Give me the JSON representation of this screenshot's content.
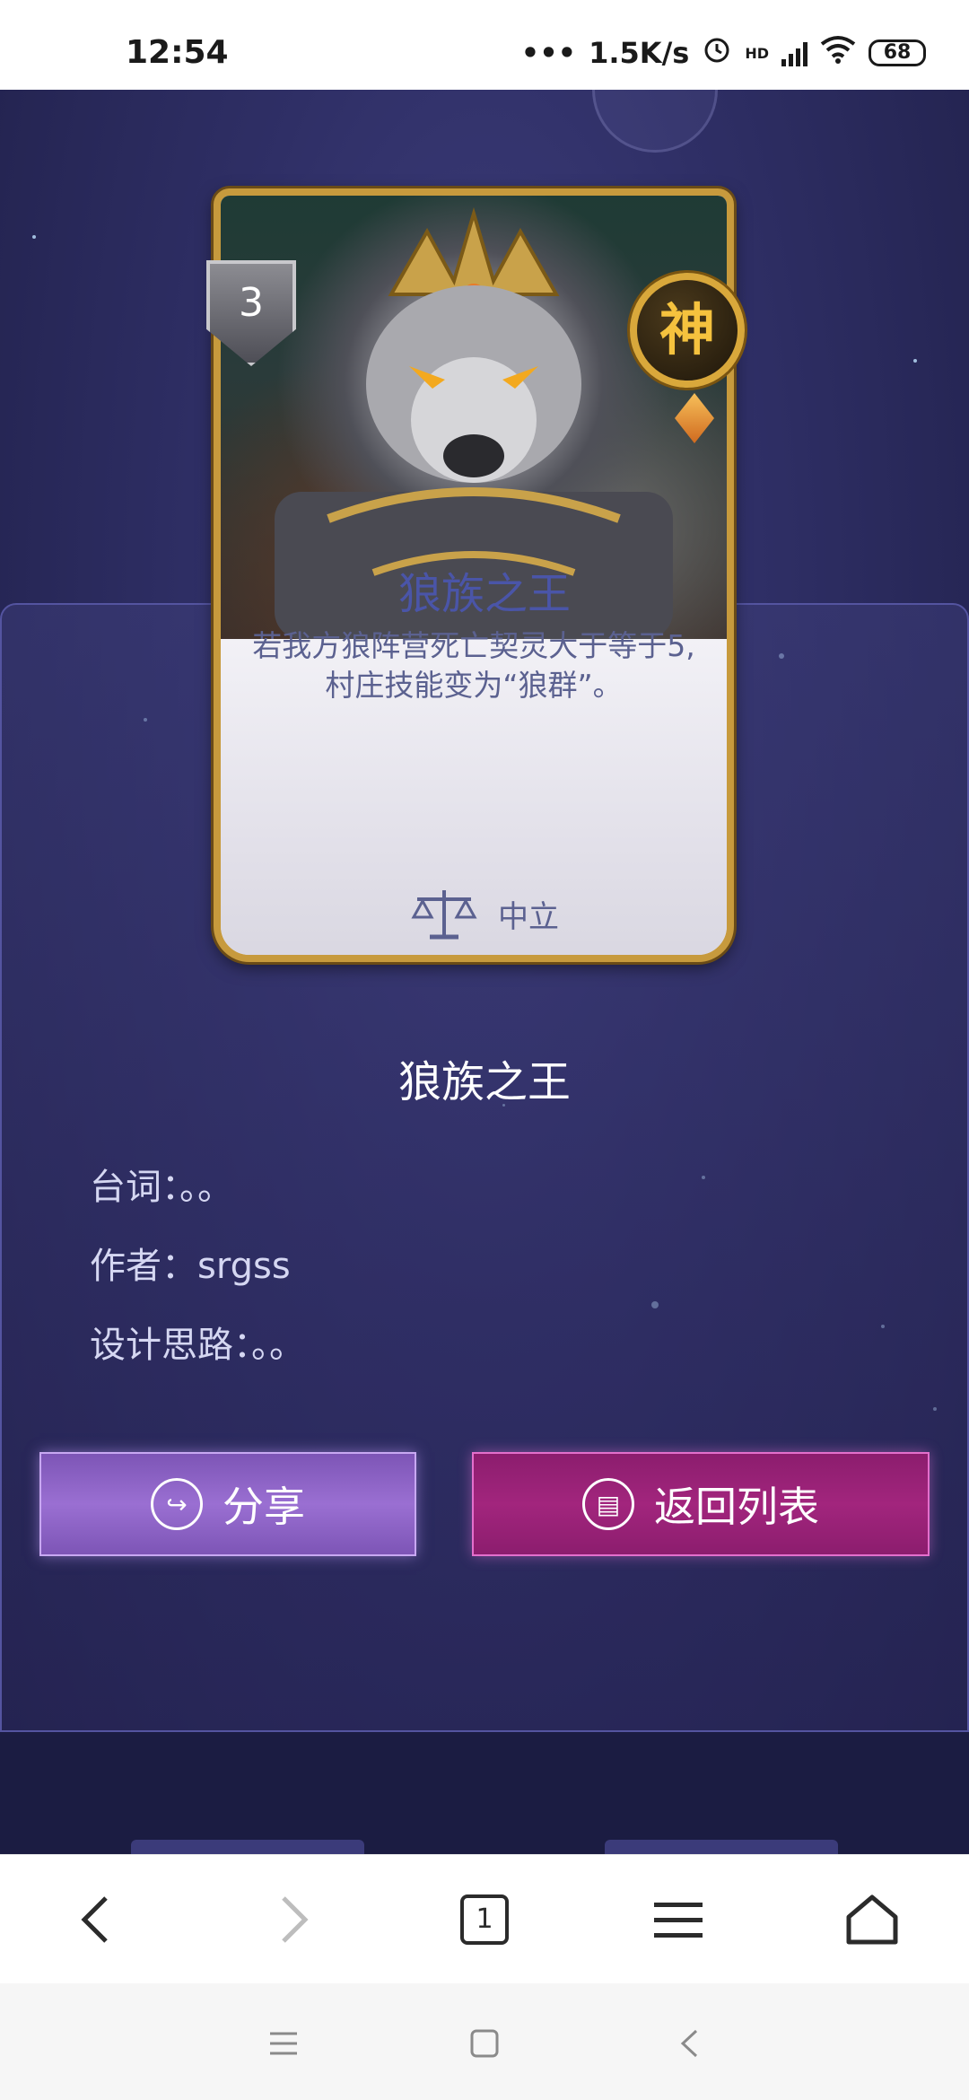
{
  "status_bar": {
    "time": "12:54",
    "network_speed": "1.5K/s",
    "network_type": "HD",
    "battery": "68",
    "icons": [
      "more-dots-icon",
      "alarm-icon",
      "signal-icon",
      "wifi-icon",
      "battery-icon"
    ]
  },
  "card": {
    "cost": "3",
    "rank": "神",
    "name": "狼族之王",
    "description": "若我方狼阵营死亡契灵大于等于5,村庄技能变为“狼群”。",
    "faction": "中立",
    "faction_icon": "balance-scale-icon"
  },
  "info": {
    "title": "狼族之王",
    "line_label": "台词：",
    "line_value": "。。",
    "author_label": "作者：",
    "author_value": "srgss",
    "idea_label": "设计思路：",
    "idea_value": "。。"
  },
  "buttons": {
    "share_label": "分享",
    "share_icon": "share-icon",
    "back_label": "返回列表",
    "back_icon": "card-list-icon",
    "share_color": "#8a63c4",
    "back_color": "#9a2378"
  },
  "browser_toolbar": {
    "tab_count": "1",
    "icons": [
      "back-arrow-icon",
      "forward-arrow-icon",
      "tabs-icon",
      "menu-icon",
      "home-icon"
    ]
  },
  "system_nav": {
    "icons": [
      "recent-apps-icon",
      "home-square-icon",
      "system-back-icon"
    ]
  },
  "colors": {
    "background": "#2f2f66",
    "card_title": "#4a55a8",
    "card_frame": "#c79a3d"
  }
}
